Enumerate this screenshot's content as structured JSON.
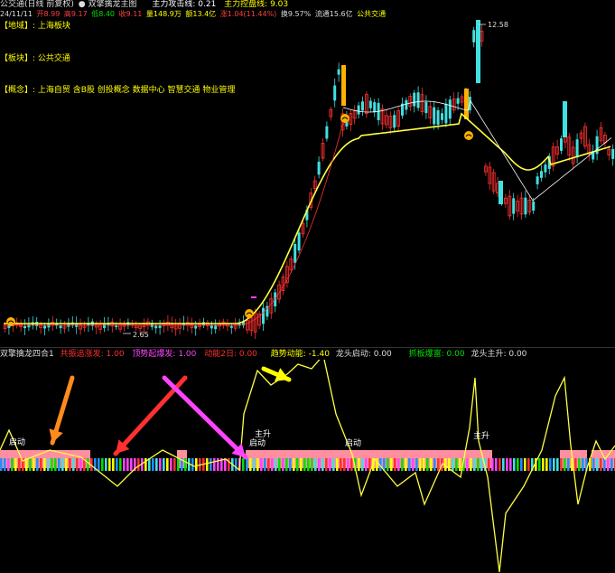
{
  "header": {
    "line1": [
      {
        "text": "公交通(日线 前复权)",
        "color": "#dddddd"
      },
      {
        "text": "● 双擎擒龙主图",
        "color": "#dddddd"
      },
      {
        "text": "主力攻击线: 0.21",
        "color": "#ffffff"
      },
      {
        "text": "主力控盘线: 9.03",
        "color": "#ffff00"
      }
    ],
    "line2": [
      {
        "text": "24/11/11",
        "color": "#dddddd"
      },
      {
        "text": "开8.99",
        "color": "#ff4040"
      },
      {
        "text": "高9.17",
        "color": "#ff4040"
      },
      {
        "text": "低8.40",
        "color": "#00e000"
      },
      {
        "text": "收9.11",
        "color": "#ff4040"
      },
      {
        "text": "量148.9万",
        "color": "#ffff00"
      },
      {
        "text": "额13.4亿",
        "color": "#ffff00"
      },
      {
        "text": "涨1.04(11.44%)",
        "color": "#ff4040"
      },
      {
        "text": "换9.57%",
        "color": "#dddddd"
      },
      {
        "text": "流通15.6亿",
        "color": "#dddddd"
      },
      {
        "text": "公共交通",
        "color": "#ffff00"
      }
    ],
    "region": "【地域】: 上海板块",
    "sector": "【板块】: 公共交通",
    "concept": "【概念】: 上海自贸 含B股 创投概念 数据中心 智慧交通 物业管理"
  },
  "price_labels": {
    "high": "12.58",
    "low": "2.65"
  },
  "indicator_header": [
    {
      "text": "双擎擒龙四合1",
      "color": "#dddddd"
    },
    {
      "text": "共振追涨发: 1.00",
      "color": "#ff3030"
    },
    {
      "text": "顶势起爆发: 1.00",
      "color": "#ff44ff"
    },
    {
      "text": "动能2日: 0.00",
      "color": "#ff3030"
    },
    {
      "text": "趋势动能: -1.40",
      "color": "#ffff00"
    },
    {
      "text": "龙头启动: 0.00",
      "color": "#dddddd"
    },
    {
      "text": "抓板爆富: 0.00",
      "color": "#00e000"
    },
    {
      "text": "龙头主升: 0.00",
      "color": "#dddddd"
    }
  ],
  "annotations": [
    "启动",
    "主升",
    "启动",
    "启动",
    "主升"
  ],
  "colors": {
    "up": "#ff3030",
    "down": "#40e0e0",
    "ma": "#ffff40",
    "ma2": "#ffffff",
    "ma3": "#ff3030",
    "pink": "#ff8fa0",
    "magenta": "#ff44ff",
    "orange": "#ff8c1a",
    "arrow_red": "#ff3030",
    "arrow_yellow": "#ffff00"
  },
  "bar_colors": [
    "#ff3030",
    "#ffff00",
    "#00e000",
    "#2090ff",
    "#ff44ff",
    "#40e0e0"
  ]
}
